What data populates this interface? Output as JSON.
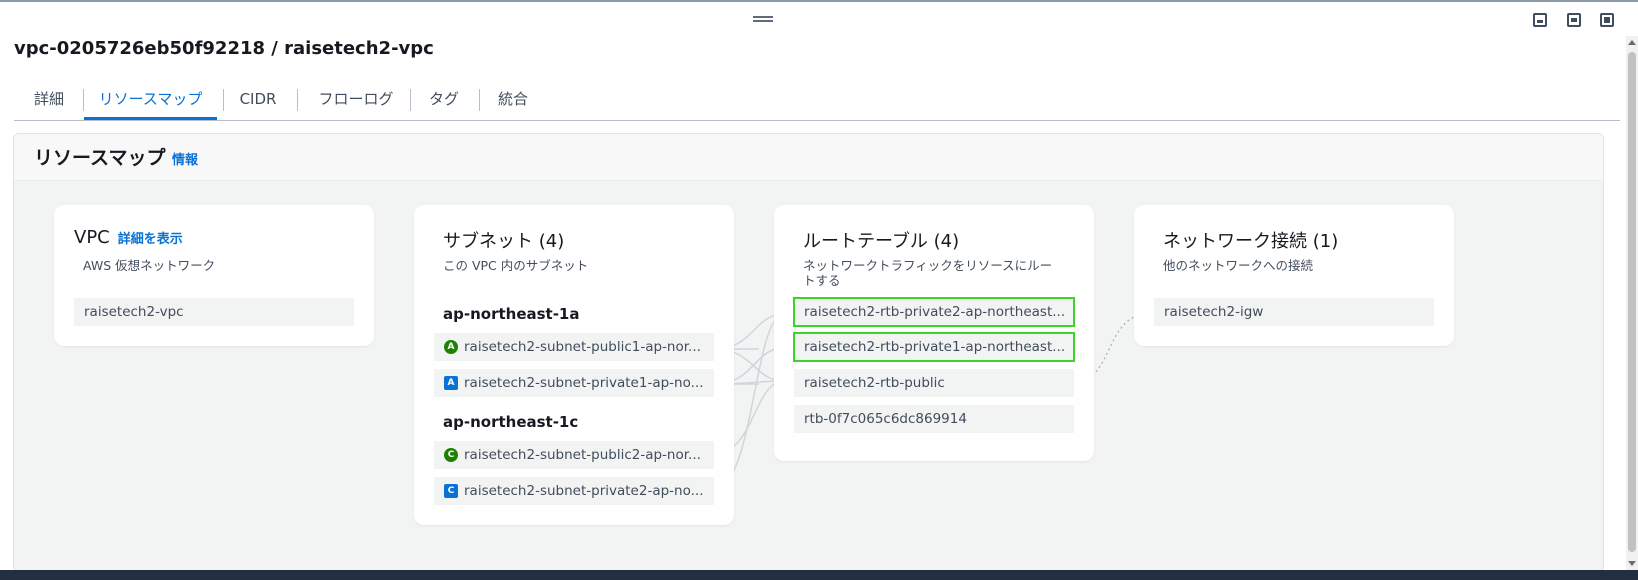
{
  "page_title": "vpc-0205726eb50f92218 / raisetech2-vpc",
  "tabs": [
    {
      "label": "詳細",
      "active": false
    },
    {
      "label": "リソースマップ",
      "active": true
    },
    {
      "label": "CIDR",
      "active": false
    },
    {
      "label": "フローログ",
      "active": false
    },
    {
      "label": "タグ",
      "active": false
    },
    {
      "label": "統合",
      "active": false
    }
  ],
  "resource_map": {
    "title": "リソースマップ",
    "info_link": "情報",
    "vpc": {
      "title": "VPC",
      "details_link": "詳細を表示",
      "subtitle": "AWS 仮想ネットワーク",
      "item": "raisetech2-vpc"
    },
    "subnets": {
      "title": "サブネット (4)",
      "subtitle": "この VPC 内のサブネット",
      "groups": [
        {
          "az": "ap-northeast-1a",
          "items": [
            {
              "badge": "A",
              "type": "public",
              "name": "raisetech2-subnet-public1-ap-nor..."
            },
            {
              "badge": "A",
              "type": "private",
              "name": "raisetech2-subnet-private1-ap-no..."
            }
          ]
        },
        {
          "az": "ap-northeast-1c",
          "items": [
            {
              "badge": "C",
              "type": "public",
              "name": "raisetech2-subnet-public2-ap-nor..."
            },
            {
              "badge": "C",
              "type": "private",
              "name": "raisetech2-subnet-private2-ap-no..."
            }
          ]
        }
      ]
    },
    "route_tables": {
      "title": "ルートテーブル (4)",
      "subtitle": "ネットワークトラフィックをリソースにルートする",
      "items": [
        {
          "name": "raisetech2-rtb-private2-ap-northeast...",
          "highlighted": true
        },
        {
          "name": "raisetech2-rtb-private1-ap-northeast...",
          "highlighted": true
        },
        {
          "name": "raisetech2-rtb-public",
          "highlighted": false
        },
        {
          "name": "rtb-0f7c065c6dc869914",
          "highlighted": false
        }
      ]
    },
    "network_connections": {
      "title": "ネットワーク接続 (1)",
      "subtitle": "他のネットワークへの接続",
      "items": [
        "raisetech2-igw"
      ]
    }
  },
  "colors": {
    "link": "#0972d3",
    "highlight": "#3dd42a",
    "public_badge": "#1d8102",
    "private_badge": "#0972d3"
  }
}
